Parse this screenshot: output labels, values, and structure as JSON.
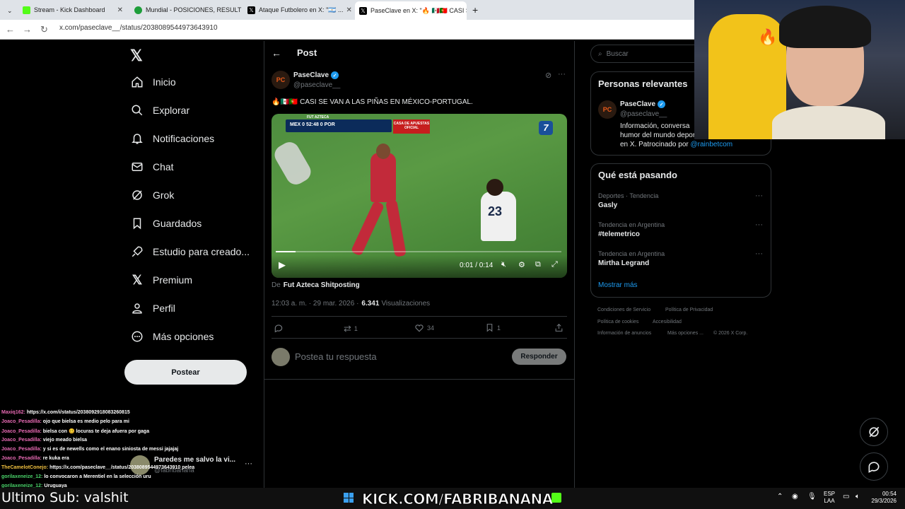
{
  "browser": {
    "tabs": [
      {
        "title": "Stream - Kick Dashboard",
        "color": "#53fc18"
      },
      {
        "title": "Mundial - POSICIONES, RESULT",
        "color": "#1e9e3a"
      },
      {
        "title": "Ataque Futbolero en X: \"🇦🇷 ...",
        "color": "#000000"
      },
      {
        "title": "PaseClave en X: \"🔥 🇲🇽🇵🇹 CASI S",
        "color": "#000000"
      }
    ],
    "url": "x.com/paseclave__/status/2038089544973643910"
  },
  "nav": {
    "logo": "𝕏",
    "items": [
      {
        "label": "Inicio",
        "icon": "home-icon"
      },
      {
        "label": "Explorar",
        "icon": "search-icon"
      },
      {
        "label": "Notificaciones",
        "icon": "bell-icon"
      },
      {
        "label": "Chat",
        "icon": "mail-icon"
      },
      {
        "label": "Grok",
        "icon": "grok-icon"
      },
      {
        "label": "Guardados",
        "icon": "bookmark-icon"
      },
      {
        "label": "Estudio para creado...",
        "icon": "rocket-icon"
      },
      {
        "label": "Premium",
        "icon": "x-icon"
      },
      {
        "label": "Perfil",
        "icon": "person-icon"
      },
      {
        "label": "Más opciones",
        "icon": "more-circle-icon"
      }
    ],
    "post_button": "Postear"
  },
  "post": {
    "header": "Post",
    "author_name": "PaseClave",
    "author_handle": "@paseclave__",
    "avatar_text": "PC",
    "text": "🔥🇲🇽🇵🇹 CASI SE VAN A LAS PIÑAS EN MÉXICO-PORTUGAL.",
    "video": {
      "time": "0:01 / 0:14",
      "progress": 0.07,
      "scorebug": "MEX 0  52:48  0 POR",
      "ad_text": "CASA DE APUESTAS OFICIAL",
      "channel": "7",
      "network": "FUT AZTECA",
      "jersey_number": "23"
    },
    "source_prefix": "De",
    "source_name": "Fut Azteca Shitposting",
    "timestamp": "12:03 a. m. · 29 mar. 2026 ·",
    "views_count": "6.341",
    "views_label": "Visualizaciones",
    "stats": {
      "replies": "",
      "reposts": "1",
      "likes": "34",
      "bookmarks": "1"
    },
    "reply_placeholder": "Postea tu respuesta",
    "reply_button": "Responder"
  },
  "sidebar": {
    "search_placeholder": "Buscar",
    "relevant_title": "Personas relevantes",
    "relevant": {
      "name": "PaseClave",
      "handle": "@paseclave__",
      "bio": "Información, conversa... humor del mundo depor... en X. Patrocinado por",
      "bio_line1": "Información, conversa",
      "bio_line2": "humor del mundo depor",
      "bio_line3": "en X. Patrocinado por",
      "sponsor": "@rainbetcom"
    },
    "trending_title": "Qué está pasando",
    "trends": [
      {
        "category": "Deportes · Tendencia",
        "name": "Gasly"
      },
      {
        "category": "Tendencia en Argentina",
        "name": "#telemetrico"
      },
      {
        "category": "Tendencia en Argentina",
        "name": "Mirtha Legrand"
      }
    ],
    "show_more": "Mostrar más",
    "footer": [
      "Condiciones de Servicio",
      "Política de Privacidad",
      "Política de cookies",
      "Accesibilidad",
      "Información de anuncios",
      "Más opciones ...",
      "© 2026 X Corp."
    ]
  },
  "account_switcher": {
    "name": "Paredes me salvo la vi...",
    "handle": "@fabribanana"
  },
  "chat": [
    {
      "user": "Maxiq162:",
      "msg": "https://x.com/i/status/2038092918083260815"
    },
    {
      "user": "Joaco_Pesadilla:",
      "msg": "ojo que bielsa es medio pelo para mi"
    },
    {
      "user": "Joaco_Pesadilla:",
      "msg": "bielsa con 🥴 locuras te deja afuera por gaga"
    },
    {
      "user": "Joaco_Pesadilla:",
      "msg": "viejo meado bielsa"
    },
    {
      "user": "Joaco_Pesadilla:",
      "msg": "y si es de newells como el enano siniosta de messi jajajaj"
    },
    {
      "user": "Joaco_Pesadilla:",
      "msg": "re kuka era"
    },
    {
      "user": "TheCamelotConejo:",
      "msg": "https://x.com/paseclave__/status/2038089544973643910 pelea"
    },
    {
      "user": "gorilaxeneize_12:",
      "msg": "lo convocaron a Merentiel en la selección uru"
    },
    {
      "user": "gorilaxeneize_12:",
      "msg": "Uruguaya"
    }
  ],
  "overlay": {
    "last_sub": "Ultimo Sub: valshit",
    "kick_url": "KICK.COM/FABRIBANANA"
  },
  "taskbar": {
    "lang1": "ESP",
    "lang2": "LAA",
    "time": "00:54",
    "date": "29/3/2026"
  }
}
